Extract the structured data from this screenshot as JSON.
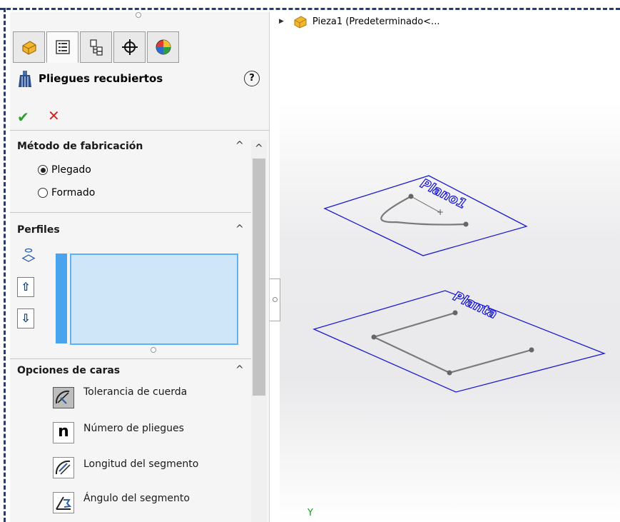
{
  "tabs": [
    {
      "name": "feature-manager",
      "icon": "part-cube-icon"
    },
    {
      "name": "property-manager",
      "icon": "property-list-icon",
      "active": true
    },
    {
      "name": "configuration-manager",
      "icon": "configuration-icon"
    },
    {
      "name": "dimxpert-manager",
      "icon": "crosshair-icon"
    },
    {
      "name": "display-manager",
      "icon": "appearance-sphere-icon"
    }
  ],
  "property_manager": {
    "title": "Pliegues recubiertos",
    "help_label": "?",
    "ok_label": "✔",
    "cancel_label": "✕"
  },
  "sections": {
    "method": {
      "title": "Método de fabricación",
      "options": [
        {
          "label": "Plegado",
          "selected": true
        },
        {
          "label": "Formado",
          "selected": false
        }
      ]
    },
    "profiles": {
      "title": "Perfiles",
      "up_label": "⇧",
      "down_label": "⇩"
    },
    "face_options": {
      "title": "Opciones de caras",
      "items": [
        {
          "label": "Tolerancia de cuerda",
          "icon": "chord-tolerance-icon",
          "active": true
        },
        {
          "label": "Número de pliegues",
          "icon": "number-of-bends-icon",
          "glyph": "n"
        },
        {
          "label": "Longitud del segmento",
          "icon": "segment-length-icon"
        },
        {
          "label": "Ángulo del segmento",
          "icon": "segment-angle-icon"
        }
      ]
    }
  },
  "tree": {
    "item_label": "Pieza1  (Predeterminado<..."
  },
  "viewport": {
    "plane_top_label": "Plano1",
    "plane_bottom_label": "Planta",
    "axis_label": "Y",
    "plane_color": "#1b1bd0",
    "sketch_color": "#7a7a7a"
  },
  "colors": {
    "ok": "#2f9e2f",
    "cancel": "#e0201e",
    "selection_blue": "#4aa3ef"
  }
}
